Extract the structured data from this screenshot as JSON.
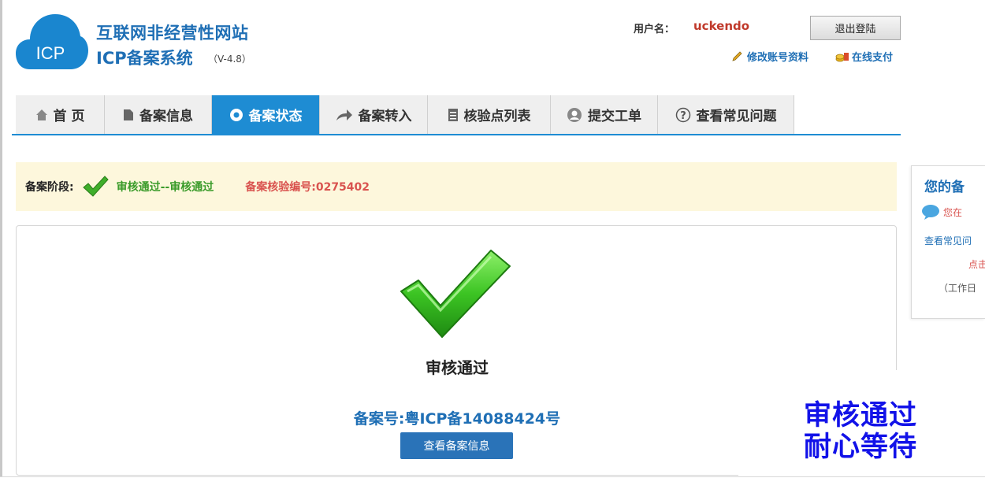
{
  "header": {
    "site_title": "互联网非经营性网站",
    "system_title": "ICP备案系统",
    "version": "（V-4.8）",
    "logo_text": "ICP",
    "username_label": "用户名：",
    "username": "uckendo",
    "logout_label": "退出登陆",
    "edit_account_label": "修改账号资料",
    "online_pay_label": "在线支付"
  },
  "nav": {
    "items": [
      {
        "label": "首 页",
        "icon": "home-icon"
      },
      {
        "label": "备案信息",
        "icon": "document-icon"
      },
      {
        "label": "备案状态",
        "icon": "status-icon",
        "active": true
      },
      {
        "label": "备案转入",
        "icon": "arrow-forward-icon"
      },
      {
        "label": "核验点列表",
        "icon": "list-icon"
      },
      {
        "label": "提交工单",
        "icon": "user-icon"
      },
      {
        "label": "查看常见问题",
        "icon": "help-icon"
      }
    ]
  },
  "stage": {
    "label": "备案阶段:",
    "status": "审核通过--审核通过",
    "verify_code": "备案核验编号:0275402"
  },
  "main": {
    "approved_title": "审核通过",
    "record_number": "备案号:粤ICP备14088424号",
    "view_button": "查看备案信息"
  },
  "side": {
    "title": "您的备",
    "chat": "您在",
    "faq": "查看常见问",
    "click": "点击",
    "work": "（工作日"
  },
  "overlay": {
    "line1": "审核通过",
    "line2": "耐心等待"
  },
  "colors": {
    "brand_blue": "#1e8cd3",
    "link_blue": "#1f6fb5",
    "success_green": "#3a9b2a",
    "alert_red": "#d9534f",
    "overlay_blue": "#1212e8"
  }
}
